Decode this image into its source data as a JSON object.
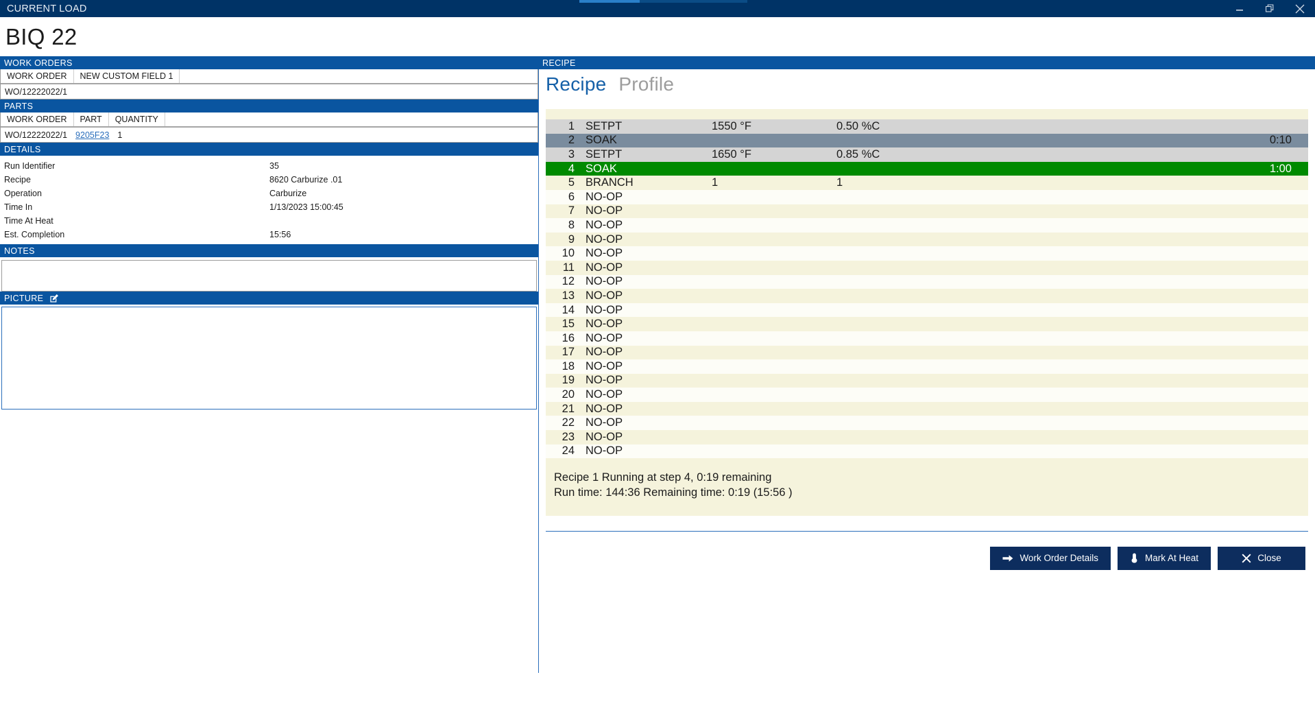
{
  "window": {
    "title": "CURRENT LOAD",
    "minimize_icon": "minimize-icon",
    "restore_icon": "restore-icon",
    "close_icon": "close-icon"
  },
  "page": {
    "title": "BIQ 22"
  },
  "work_orders": {
    "section_title": "WORK ORDERS",
    "columns": [
      "WORK ORDER",
      "NEW CUSTOM FIELD 1"
    ],
    "rows": [
      {
        "work_order": "WO/12222022/1",
        "new_custom_field_1": ""
      }
    ]
  },
  "parts": {
    "section_title": "PARTS",
    "columns": [
      "WORK ORDER",
      "PART",
      "QUANTITY"
    ],
    "rows": [
      {
        "work_order": "WO/12222022/1",
        "part": "9205F23",
        "quantity": "1"
      }
    ]
  },
  "details": {
    "section_title": "DETAILS",
    "rows": [
      {
        "label": "Run Identifier",
        "value": "35"
      },
      {
        "label": "Recipe",
        "value": "8620 Carburize .01"
      },
      {
        "label": "Operation",
        "value": "Carburize"
      },
      {
        "label": "Time In",
        "value": "1/13/2023 15:00:45"
      },
      {
        "label": "Time At Heat",
        "value": ""
      },
      {
        "label": "Est. Completion",
        "value": "15:56"
      }
    ]
  },
  "notes": {
    "section_title": "NOTES",
    "value": "",
    "placeholder": ""
  },
  "picture": {
    "section_title": "PICTURE",
    "edit_icon": "edit-pencil-icon"
  },
  "recipe": {
    "section_title": "RECIPE",
    "tabs": [
      {
        "label": "Recipe",
        "active": true
      },
      {
        "label": "Profile",
        "active": false
      }
    ],
    "steps": [
      {
        "num": "1",
        "op": "SETPT",
        "v1": "1550 °F",
        "v2": "0.50 %C",
        "time": "",
        "shade": "gray"
      },
      {
        "num": "2",
        "op": "SOAK",
        "v1": "",
        "v2": "",
        "time": "0:10",
        "shade": "slate"
      },
      {
        "num": "3",
        "op": "SETPT",
        "v1": "1650 °F",
        "v2": "0.85 %C",
        "time": "",
        "shade": "gray"
      },
      {
        "num": "4",
        "op": "SOAK",
        "v1": "",
        "v2": "",
        "time": "1:00",
        "shade": "green"
      },
      {
        "num": "5",
        "op": "BRANCH",
        "v1": "1",
        "v2": "1",
        "time": "",
        "shade": "cream"
      },
      {
        "num": "6",
        "op": "NO-OP",
        "v1": "",
        "v2": "",
        "time": "",
        "shade": "white"
      },
      {
        "num": "7",
        "op": "NO-OP",
        "v1": "",
        "v2": "",
        "time": "",
        "shade": "cream"
      },
      {
        "num": "8",
        "op": "NO-OP",
        "v1": "",
        "v2": "",
        "time": "",
        "shade": "white"
      },
      {
        "num": "9",
        "op": "NO-OP",
        "v1": "",
        "v2": "",
        "time": "",
        "shade": "cream"
      },
      {
        "num": "10",
        "op": "NO-OP",
        "v1": "",
        "v2": "",
        "time": "",
        "shade": "white"
      },
      {
        "num": "11",
        "op": "NO-OP",
        "v1": "",
        "v2": "",
        "time": "",
        "shade": "cream"
      },
      {
        "num": "12",
        "op": "NO-OP",
        "v1": "",
        "v2": "",
        "time": "",
        "shade": "white"
      },
      {
        "num": "13",
        "op": "NO-OP",
        "v1": "",
        "v2": "",
        "time": "",
        "shade": "cream"
      },
      {
        "num": "14",
        "op": "NO-OP",
        "v1": "",
        "v2": "",
        "time": "",
        "shade": "white"
      },
      {
        "num": "15",
        "op": "NO-OP",
        "v1": "",
        "v2": "",
        "time": "",
        "shade": "cream"
      },
      {
        "num": "16",
        "op": "NO-OP",
        "v1": "",
        "v2": "",
        "time": "",
        "shade": "white"
      },
      {
        "num": "17",
        "op": "NO-OP",
        "v1": "",
        "v2": "",
        "time": "",
        "shade": "cream"
      },
      {
        "num": "18",
        "op": "NO-OP",
        "v1": "",
        "v2": "",
        "time": "",
        "shade": "white"
      },
      {
        "num": "19",
        "op": "NO-OP",
        "v1": "",
        "v2": "",
        "time": "",
        "shade": "cream"
      },
      {
        "num": "20",
        "op": "NO-OP",
        "v1": "",
        "v2": "",
        "time": "",
        "shade": "white"
      },
      {
        "num": "21",
        "op": "NO-OP",
        "v1": "",
        "v2": "",
        "time": "",
        "shade": "cream"
      },
      {
        "num": "22",
        "op": "NO-OP",
        "v1": "",
        "v2": "",
        "time": "",
        "shade": "white"
      },
      {
        "num": "23",
        "op": "NO-OP",
        "v1": "",
        "v2": "",
        "time": "",
        "shade": "cream"
      },
      {
        "num": "24",
        "op": "NO-OP",
        "v1": "",
        "v2": "",
        "time": "",
        "shade": "white"
      }
    ],
    "status_line_1": "Recipe 1 Running at step 4, 0:19 remaining",
    "status_line_2": "Run time: 144:36 Remaining time: 0:19 (15:56 )"
  },
  "footer": {
    "buttons": [
      {
        "label": "Work Order Details",
        "icon": "arrow-right-icon"
      },
      {
        "label": "Mark At Heat",
        "icon": "thermometer-icon"
      },
      {
        "label": "Close",
        "icon": "close-x-icon"
      }
    ]
  }
}
